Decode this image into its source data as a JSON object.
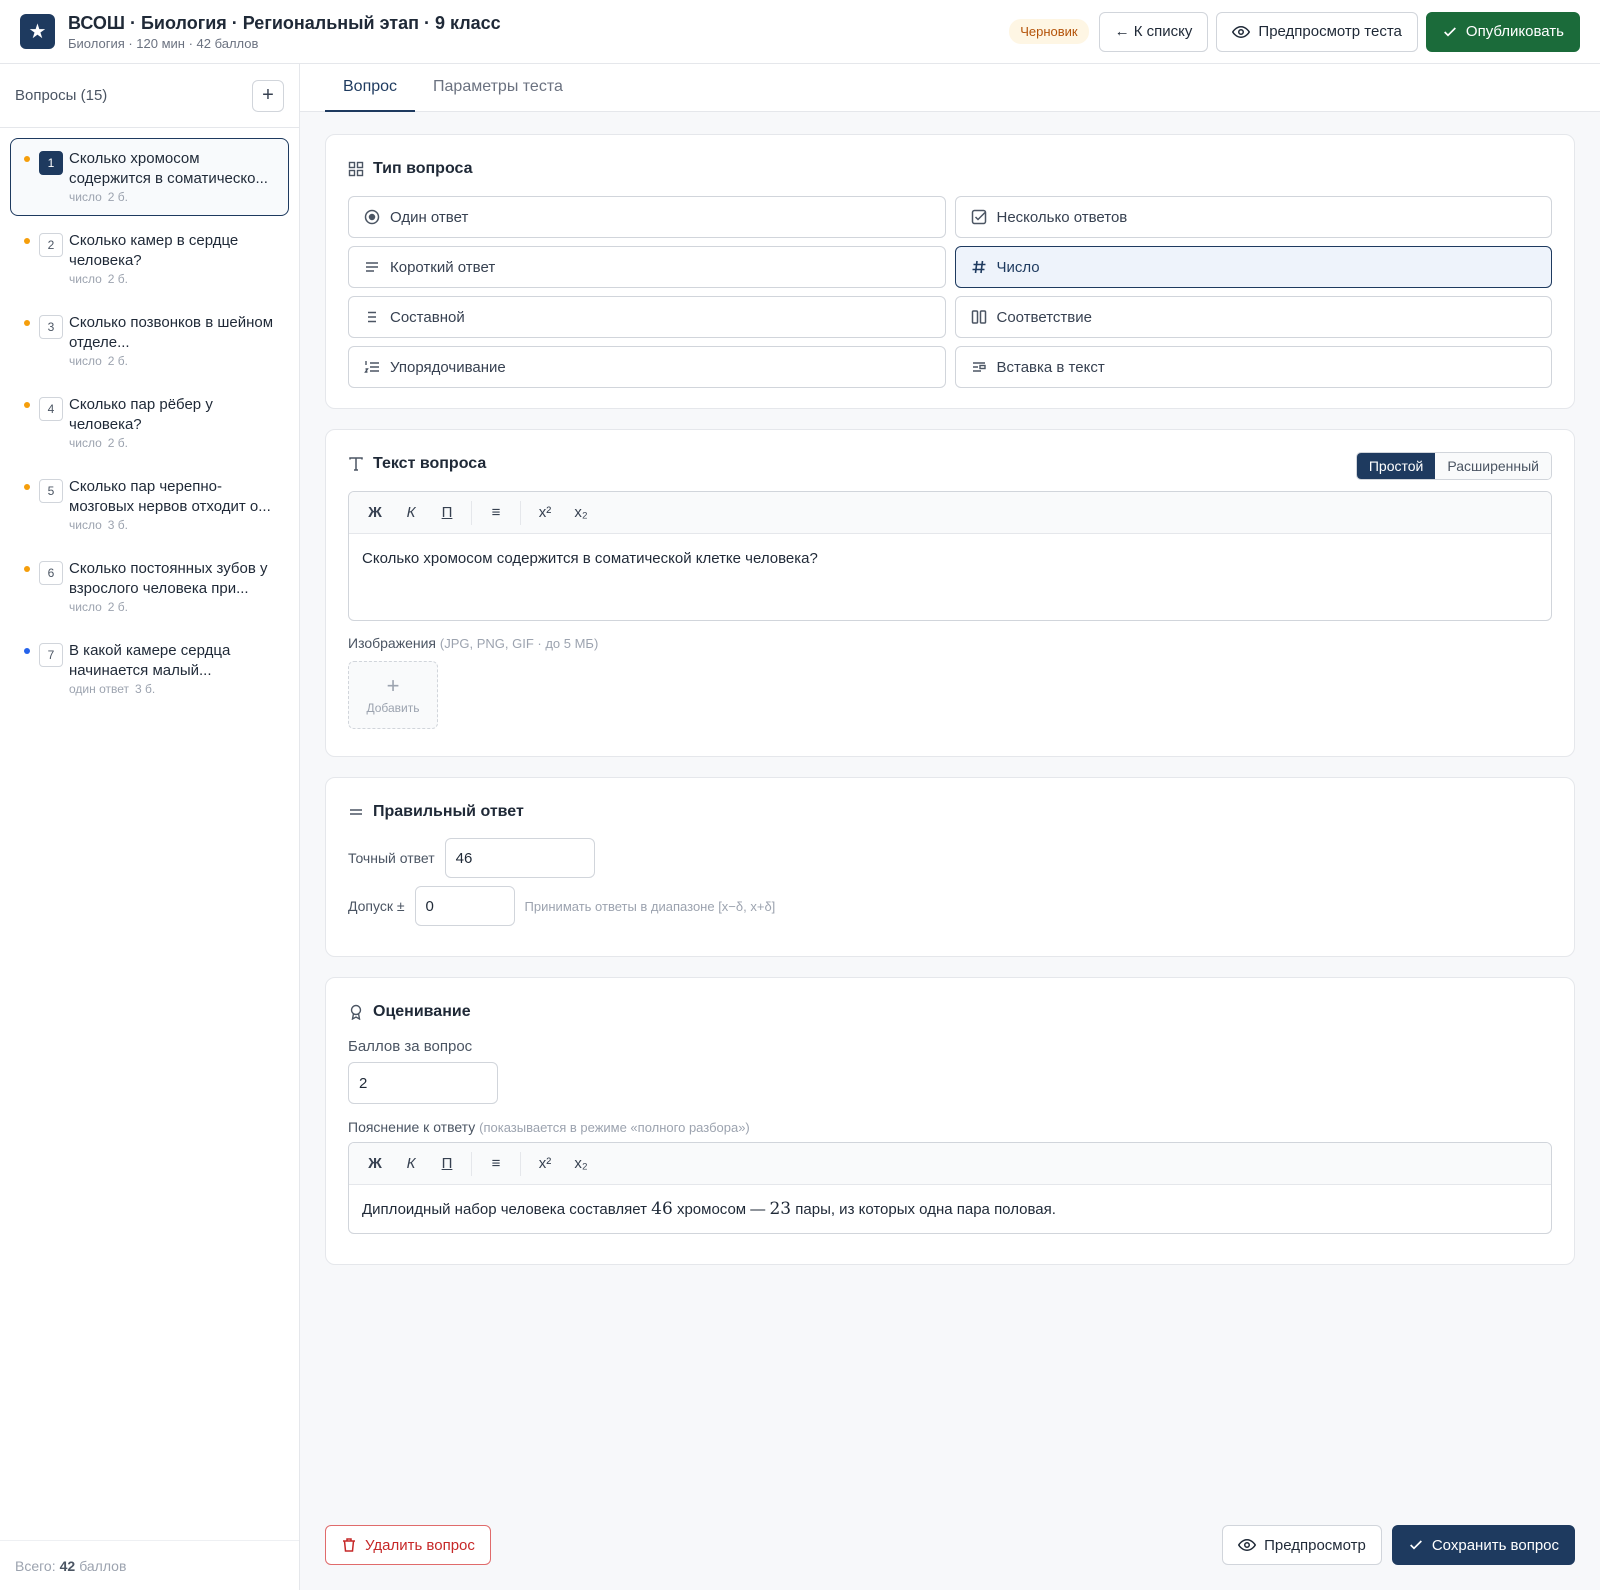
{
  "header": {
    "logo_glyph": "★",
    "title": "ВСОШ · Биология · Региональный этап · 9 класс",
    "subtitle": "Биология · 120 мин · 42 баллов",
    "status_badge": "Черновик",
    "back_label": "← К списку",
    "preview_label": "Предпросмотр теста",
    "publish_label": "Опубликовать"
  },
  "sidebar": {
    "title": "Вопросы (15)",
    "add_label": "+",
    "items": [
      {
        "num": "1",
        "text": "Сколько хромосом содержится в соматическо...",
        "type": "число",
        "points": "2 б."
      },
      {
        "num": "2",
        "text": "Сколько камер в сердце человека?",
        "type": "число",
        "points": "2 б."
      },
      {
        "num": "3",
        "text": "Сколько позвонков в шейном отделе...",
        "type": "число",
        "points": "2 б."
      },
      {
        "num": "4",
        "text": "Сколько пар рёбер у человека?",
        "type": "число",
        "points": "2 б."
      },
      {
        "num": "5",
        "text": "Сколько пар черепно-мозговых нервов отходит о...",
        "type": "число",
        "points": "3 б."
      },
      {
        "num": "6",
        "text": "Сколько постоянных зубов у взрослого человека при...",
        "type": "число",
        "points": "2 б."
      },
      {
        "num": "7",
        "text": "В какой камере сердца начинается малый...",
        "type": "один ответ",
        "points": "3 б."
      }
    ],
    "footer_prefix": "Всего:",
    "footer_total": "42",
    "footer_suffix": "баллов"
  },
  "tabs": {
    "question": "Вопрос",
    "settings": "Параметры теста"
  },
  "question_type": {
    "title": "Тип вопроса",
    "options": [
      {
        "label": "Один ответ",
        "icon": "radio-icon"
      },
      {
        "label": "Несколько ответов",
        "icon": "checkbox-icon"
      },
      {
        "label": "Короткий ответ",
        "icon": "lines-icon"
      },
      {
        "label": "Число",
        "icon": "hash-icon"
      },
      {
        "label": "Составной",
        "icon": "list-icon"
      },
      {
        "label": "Соответствие",
        "icon": "columns-icon"
      },
      {
        "label": "Упорядочивание",
        "icon": "ordered-list-icon"
      },
      {
        "label": "Вставка в текст",
        "icon": "text-insert-icon"
      }
    ],
    "selected": "Число"
  },
  "question_text": {
    "title": "Текст вопроса",
    "mode_simple": "Простой",
    "mode_advanced": "Расширенный",
    "toolbar": {
      "bold": "Ж",
      "italic": "К",
      "underline": "П",
      "list": "≡",
      "sup": "x²",
      "sub": "x₂"
    },
    "body": "Сколько хромосом содержится в соматической клетке человека?",
    "images_label": "Изображения",
    "images_hint": "(JPG, PNG, GIF · до 5 МБ)",
    "add_image_label": "Добавить"
  },
  "answer": {
    "title": "Правильный ответ",
    "exact_label": "Точный ответ",
    "exact_value": "46",
    "tolerance_label": "Допуск ±",
    "tolerance_value": "0",
    "tolerance_hint": "Принимать ответы в диапазоне [x−δ, x+δ]"
  },
  "grading": {
    "title": "Оценивание",
    "points_label": "Баллов за вопрос",
    "points_value": "2",
    "explanation_label": "Пояснение к ответу",
    "explanation_hint": "(показывается в режиме «полного разбора»)",
    "explanation_pre": "Диплоидный набор человека составляет ",
    "explanation_n1": "46",
    "explanation_mid": " хромосом — ",
    "explanation_n2": "23",
    "explanation_post": " пары, из которых одна пара половая."
  },
  "footer": {
    "delete_label": "Удалить вопрос",
    "preview_label": "Предпросмотр",
    "save_label": "Сохранить вопрос"
  },
  "colors": {
    "navy": "#1e3a5f",
    "green": "#1b6b3a",
    "draft_badge": "#b45309",
    "danger": "#c62828",
    "dot_orange": "#f59e0b",
    "dot_blue": "#2563eb"
  }
}
